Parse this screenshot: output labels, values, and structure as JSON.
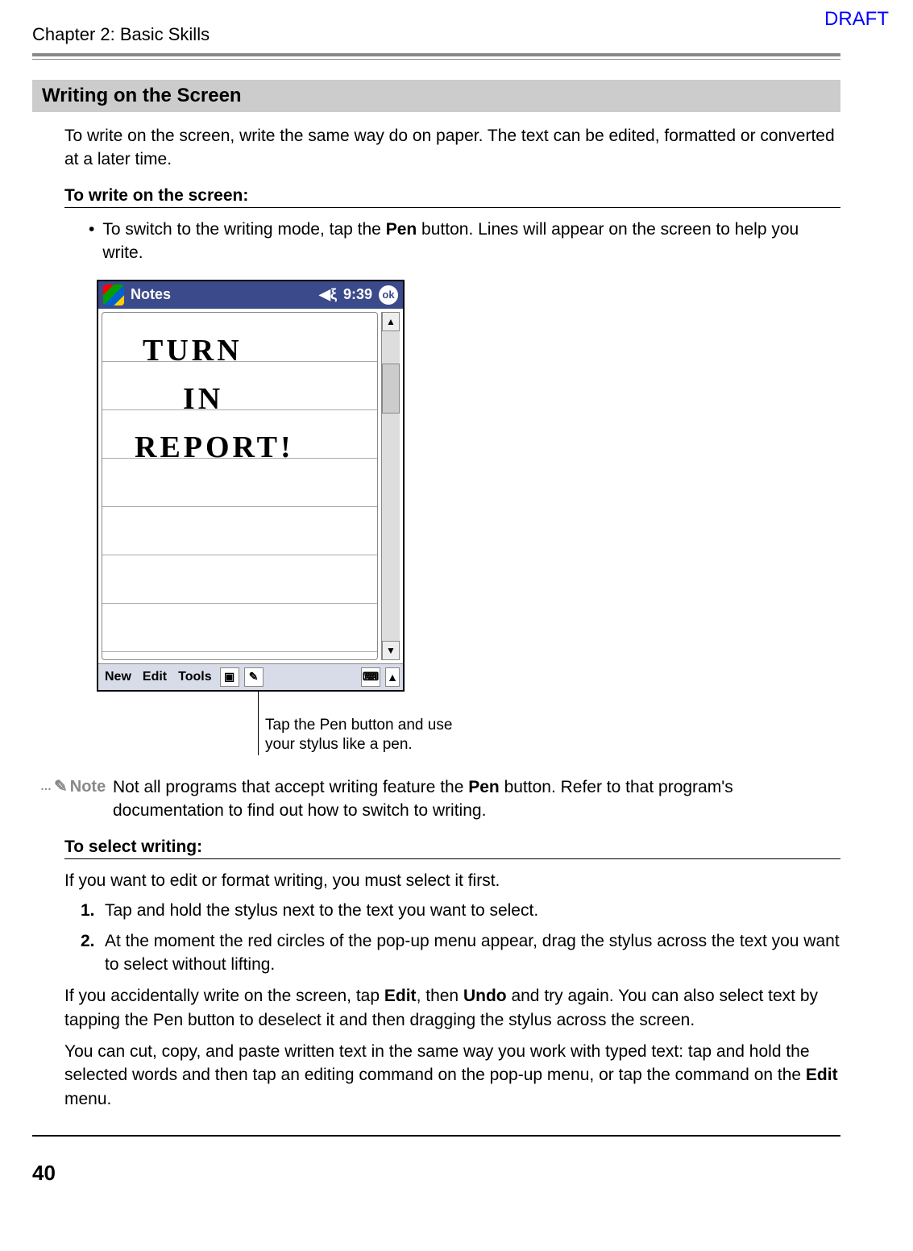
{
  "header": {
    "chapter": "Chapter 2: Basic Skills",
    "draft": "DRAFT"
  },
  "section": {
    "title": "Writing on the Screen",
    "intro": "To write on the screen, write the same way do on paper. The text can be edited, formatted or converted at a later time."
  },
  "write_section": {
    "heading": "To write on the screen:",
    "bullet_pre": "To switch to the writing mode, tap the ",
    "bullet_bold": "Pen",
    "bullet_post": " button. Lines will appear on the screen to help you write."
  },
  "device": {
    "title": "Notes",
    "time": "9:39",
    "ok": "ok",
    "hw1": "TURN",
    "hw2": "IN",
    "hw3": "REPORT!",
    "menu_new": "New",
    "menu_edit": "Edit",
    "menu_tools": "Tools"
  },
  "callout": {
    "line1": "Tap the Pen button and use",
    "line2": "your stylus like a pen."
  },
  "note": {
    "label": "Note",
    "text_pre": "Not all programs that accept writing feature the ",
    "text_bold": "Pen",
    "text_post": " button. Refer to that program's documentation to find out how to switch to writing."
  },
  "select_section": {
    "heading": "To select writing:",
    "intro": "If you want to edit or format writing, you must select it first.",
    "step1_num": "1.",
    "step1": "Tap and hold the stylus next to the text you want to select.",
    "step2_num": "2.",
    "step2": "At the moment the red circles of the pop-up menu appear, drag the stylus across the text you want to select without lifting.",
    "para2_pre": "If you accidentally write on the screen, tap ",
    "para2_b1": "Edit",
    "para2_mid": ", then ",
    "para2_b2": "Undo",
    "para2_post": " and try again. You can also select text by tapping the Pen button to deselect it and then dragging the stylus across the screen.",
    "para3_pre": "You can cut, copy, and paste written text in the same way you work with typed text: tap and hold the selected words and then tap an editing command on the pop-up menu, or tap the command on the ",
    "para3_b": "Edit",
    "para3_post": " menu."
  },
  "footer": {
    "page": "40"
  }
}
